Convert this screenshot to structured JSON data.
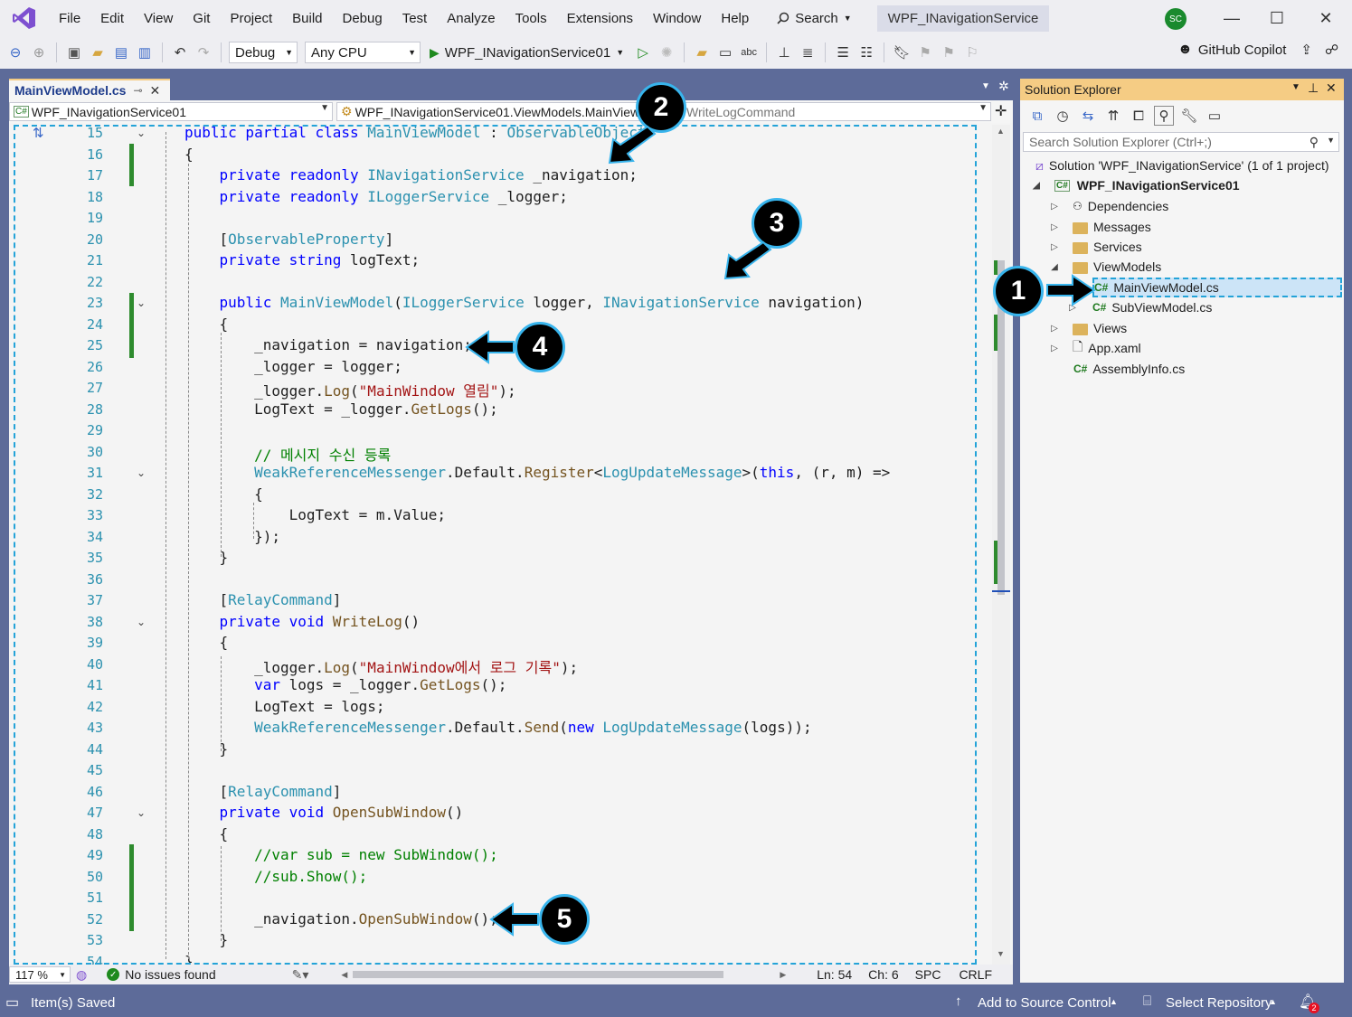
{
  "menu": {
    "items": [
      "File",
      "Edit",
      "View",
      "Git",
      "Project",
      "Build",
      "Debug",
      "Test",
      "Analyze",
      "Tools",
      "Extensions",
      "Window",
      "Help"
    ],
    "search_label": "Search",
    "solution_title": "WPF_INavigationService",
    "avatar_initials": "SC"
  },
  "toolbar": {
    "config": "Debug",
    "platform": "Any CPU",
    "run_target": "WPF_INavigationService01",
    "copilot_label": "GitHub Copilot"
  },
  "doc_tab": {
    "title": "MainViewModel.cs"
  },
  "nav_bar": {
    "project": "WPF_INavigationService01",
    "type_scope": "WPF_INavigationService01.ViewModels.MainViewModel",
    "member": "WriteLogCommand"
  },
  "code_lines": [
    {
      "n": "15",
      "html": "<span class=\"kw\">public partial class</span> <span class=\"ty\">MainViewModel</span> : <span class=\"ty\">ObservableObject</span>"
    },
    {
      "n": "16",
      "html": "{"
    },
    {
      "n": "17",
      "html": "    <span class=\"kw\">private readonly</span> <span class=\"ty\">INavigationService</span> _navigation;"
    },
    {
      "n": "18",
      "html": "    <span class=\"kw\">private readonly</span> <span class=\"ty\">ILoggerService</span> _logger;"
    },
    {
      "n": "19",
      "html": ""
    },
    {
      "n": "20",
      "html": "    [<span class=\"at\">ObservableProperty</span>]"
    },
    {
      "n": "21",
      "html": "    <span class=\"kw\">private string</span> logText;"
    },
    {
      "n": "22",
      "html": ""
    },
    {
      "n": "23",
      "html": "    <span class=\"kw\">public</span> <span class=\"ty\">MainViewModel</span>(<span class=\"ty\">ILoggerService</span> logger, <span class=\"ty\">INavigationService</span> navigation)"
    },
    {
      "n": "24",
      "html": "    {"
    },
    {
      "n": "25",
      "html": "        _navigation = navigation;"
    },
    {
      "n": "26",
      "html": "        _logger = logger;"
    },
    {
      "n": "27",
      "html": "        _logger.<span class=\"fn\">Log</span>(<span class=\"str\">\"MainWindow 열림\"</span>);"
    },
    {
      "n": "28",
      "html": "        LogText = _logger.<span class=\"fn\">GetLogs</span>();"
    },
    {
      "n": "29",
      "html": ""
    },
    {
      "n": "30",
      "html": "        <span class=\"cm\">// 메시지 수신 등록</span>"
    },
    {
      "n": "31",
      "html": "        <span class=\"ty\">WeakReferenceMessenger</span>.Default.<span class=\"fn\">Register</span>&lt;<span class=\"ty\">LogUpdateMessage</span>&gt;(<span class=\"kw\">this</span>, (r, m) =&gt;"
    },
    {
      "n": "32",
      "html": "        {"
    },
    {
      "n": "33",
      "html": "            LogText = m.Value;"
    },
    {
      "n": "34",
      "html": "        });"
    },
    {
      "n": "35",
      "html": "    }"
    },
    {
      "n": "36",
      "html": ""
    },
    {
      "n": "37",
      "html": "    [<span class=\"at\">RelayCommand</span>]"
    },
    {
      "n": "38",
      "html": "    <span class=\"kw\">private void</span> <span class=\"fn\">WriteLog</span>()"
    },
    {
      "n": "39",
      "html": "    {"
    },
    {
      "n": "40",
      "html": "        _logger.<span class=\"fn\">Log</span>(<span class=\"str\">\"MainWindow에서 로그 기록\"</span>);"
    },
    {
      "n": "41",
      "html": "        <span class=\"kw\">var</span> logs = _logger.<span class=\"fn\">GetLogs</span>();"
    },
    {
      "n": "42",
      "html": "        LogText = logs;"
    },
    {
      "n": "43",
      "html": "        <span class=\"ty\">WeakReferenceMessenger</span>.Default.<span class=\"fn\">Send</span>(<span class=\"kw\">new</span> <span class=\"ty\">LogUpdateMessage</span>(logs));"
    },
    {
      "n": "44",
      "html": "    }"
    },
    {
      "n": "45",
      "html": ""
    },
    {
      "n": "46",
      "html": "    [<span class=\"at\">RelayCommand</span>]"
    },
    {
      "n": "47",
      "html": "    <span class=\"kw\">private void</span> <span class=\"fn\">OpenSubWindow</span>()"
    },
    {
      "n": "48",
      "html": "    {"
    },
    {
      "n": "49",
      "html": "        <span class=\"cm\">//var sub = new SubWindow();</span>"
    },
    {
      "n": "50",
      "html": "        <span class=\"cm\">//sub.Show();</span>"
    },
    {
      "n": "51",
      "html": ""
    },
    {
      "n": "52",
      "html": "        _navigation.<span class=\"fn\">OpenSubWindow</span>();"
    },
    {
      "n": "53",
      "html": "    }"
    },
    {
      "n": "54",
      "html": "}"
    }
  ],
  "editor_status": {
    "zoom": "117 %",
    "issues": "No issues found",
    "line": "Ln: 54",
    "col": "Ch: 6",
    "spc": "SPC",
    "eol": "CRLF"
  },
  "solution_explorer": {
    "title": "Solution Explorer",
    "search_placeholder": "Search Solution Explorer (Ctrl+;)",
    "solution": "Solution 'WPF_INavigationService' (1 of 1 project)",
    "project": "WPF_INavigationService01",
    "items": [
      "Dependencies",
      "Messages",
      "Services",
      "ViewModels",
      "MainViewModel.cs",
      "SubViewModel.cs",
      "Views",
      "App.xaml",
      "AssemblyInfo.cs"
    ]
  },
  "statusbar": {
    "saved": "Item(s) Saved",
    "source_control": "Add to Source Control",
    "repository": "Select Repository",
    "notifications": "2"
  },
  "callouts": [
    "1",
    "2",
    "3",
    "4",
    "5"
  ],
  "colors": {
    "accent": "#5d6b99",
    "callout_border": "#38b4ec",
    "highlight": "#f5cc84"
  }
}
